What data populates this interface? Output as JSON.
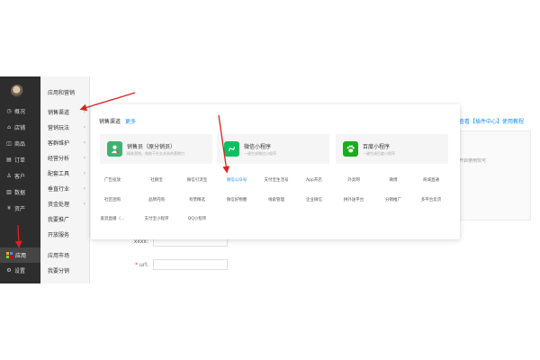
{
  "sidebar": {
    "items": [
      {
        "label": "概况",
        "icon": "clock-icon"
      },
      {
        "label": "店铺",
        "icon": "store-icon"
      },
      {
        "label": "商品",
        "icon": "bag-icon"
      },
      {
        "label": "订单",
        "icon": "list-icon"
      },
      {
        "label": "客户",
        "icon": "person-icon"
      },
      {
        "label": "数据",
        "icon": "chart-icon"
      },
      {
        "label": "资产",
        "icon": "money-icon"
      },
      {
        "label": "应用",
        "icon": "apps-grid-icon"
      },
      {
        "label": "设置",
        "icon": "gear-icon"
      }
    ]
  },
  "subnav": {
    "heading": "应用和营销",
    "items": [
      {
        "label": "销售渠道",
        "chevron": true
      },
      {
        "label": "营销玩法",
        "chevron": true
      },
      {
        "label": "客群维护",
        "chevron": true
      },
      {
        "label": "经营分析",
        "chevron": true
      },
      {
        "label": "配套工具",
        "chevron": true
      },
      {
        "label": "垂直行业",
        "chevron": true
      },
      {
        "label": "资金处理",
        "chevron": true
      },
      {
        "label": "我要推广",
        "chevron": false
      },
      {
        "label": "开放服务",
        "chevron": false
      },
      {
        "label": "应用市场",
        "chevron": false
      },
      {
        "label": "我要分销",
        "chevron": false
      }
    ]
  },
  "popover": {
    "title": "销售渠道",
    "more": "更多",
    "cards": [
      {
        "title": "销售员（原分销员）",
        "subtitle": "精准营销，借助于社交关系的营销力",
        "icon": "salesperson-icon",
        "color": "#3cb371"
      },
      {
        "title": "微信小程序",
        "subtitle": "一键生成微信小程序",
        "icon": "mini-program-icon",
        "color": "#07c160"
      },
      {
        "title": "百度小程序",
        "subtitle": "一键生成百度小程序",
        "icon": "paw-icon",
        "color": "#1aad19"
      }
    ],
    "channels": [
      [
        "广告投放",
        "社群宝",
        "微信引流宝",
        "微信公众号",
        "支付宝生活号",
        "App开店",
        "外卖网",
        "微博",
        "商城直通"
      ],
      [
        "社区团购",
        "品牌内购",
        "有赞精选",
        "微信好物圈",
        "线索管理",
        "企业微信",
        "拼外送平台",
        "分销推广",
        "多平台卖货"
      ],
      [
        "爱逛直播（…",
        "支付宝小程序",
        "QQ小程序"
      ]
    ],
    "active_channel": "微信公众号"
  },
  "main": {
    "help_link": "查看【插件中心】使用教程",
    "note": "开启使用仅可",
    "form": [
      {
        "label": "xxxx:",
        "required": false
      },
      {
        "label": "url:",
        "required": true
      }
    ]
  }
}
